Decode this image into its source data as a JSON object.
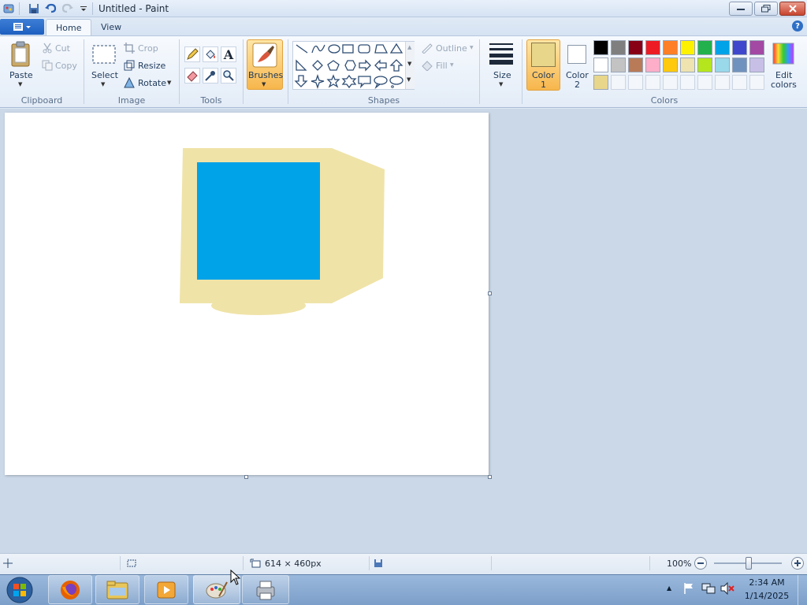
{
  "window": {
    "title": "Untitled - Paint"
  },
  "tabs": [
    {
      "label": "Home"
    },
    {
      "label": "View"
    }
  ],
  "clipboard": {
    "paste": "Paste",
    "cut": "Cut",
    "copy": "Copy",
    "label": "Clipboard"
  },
  "image": {
    "select": "Select",
    "crop": "Crop",
    "resize": "Resize",
    "rotate": "Rotate",
    "label": "Image"
  },
  "tools": {
    "label": "Tools"
  },
  "brushes": {
    "label": "Brushes"
  },
  "shapes": {
    "outline": "Outline",
    "fill": "Fill",
    "label": "Shapes"
  },
  "size": {
    "label": "Size"
  },
  "colors": {
    "color1": "Color",
    "color1_num": "1",
    "color2": "Color",
    "color2_num": "2",
    "edit1": "Edit",
    "edit2": "colors",
    "label": "Colors",
    "color1_value": "#e8d68a",
    "color2_value": "#ffffff",
    "palette_row1": [
      "#000000",
      "#7f7f7f",
      "#880015",
      "#ed1c24",
      "#ff7f27",
      "#fff200",
      "#22b14c",
      "#00a2e8",
      "#3f48cc",
      "#a349a4"
    ],
    "palette_row2": [
      "#ffffff",
      "#c3c3c3",
      "#b97a57",
      "#ffaec9",
      "#ffc90e",
      "#efe4b0",
      "#b5e61d",
      "#99d9ea",
      "#7092be",
      "#c8bfe7"
    ],
    "palette_row3": [
      "#e8d68a"
    ]
  },
  "drawing": {
    "monitor_color": "#efe3a8",
    "screen_color": "#00a2e8"
  },
  "status": {
    "dimensions": "614 × 460px",
    "zoom": "100%"
  },
  "clock": {
    "time": "2:34 AM",
    "date": "1/14/2025"
  }
}
